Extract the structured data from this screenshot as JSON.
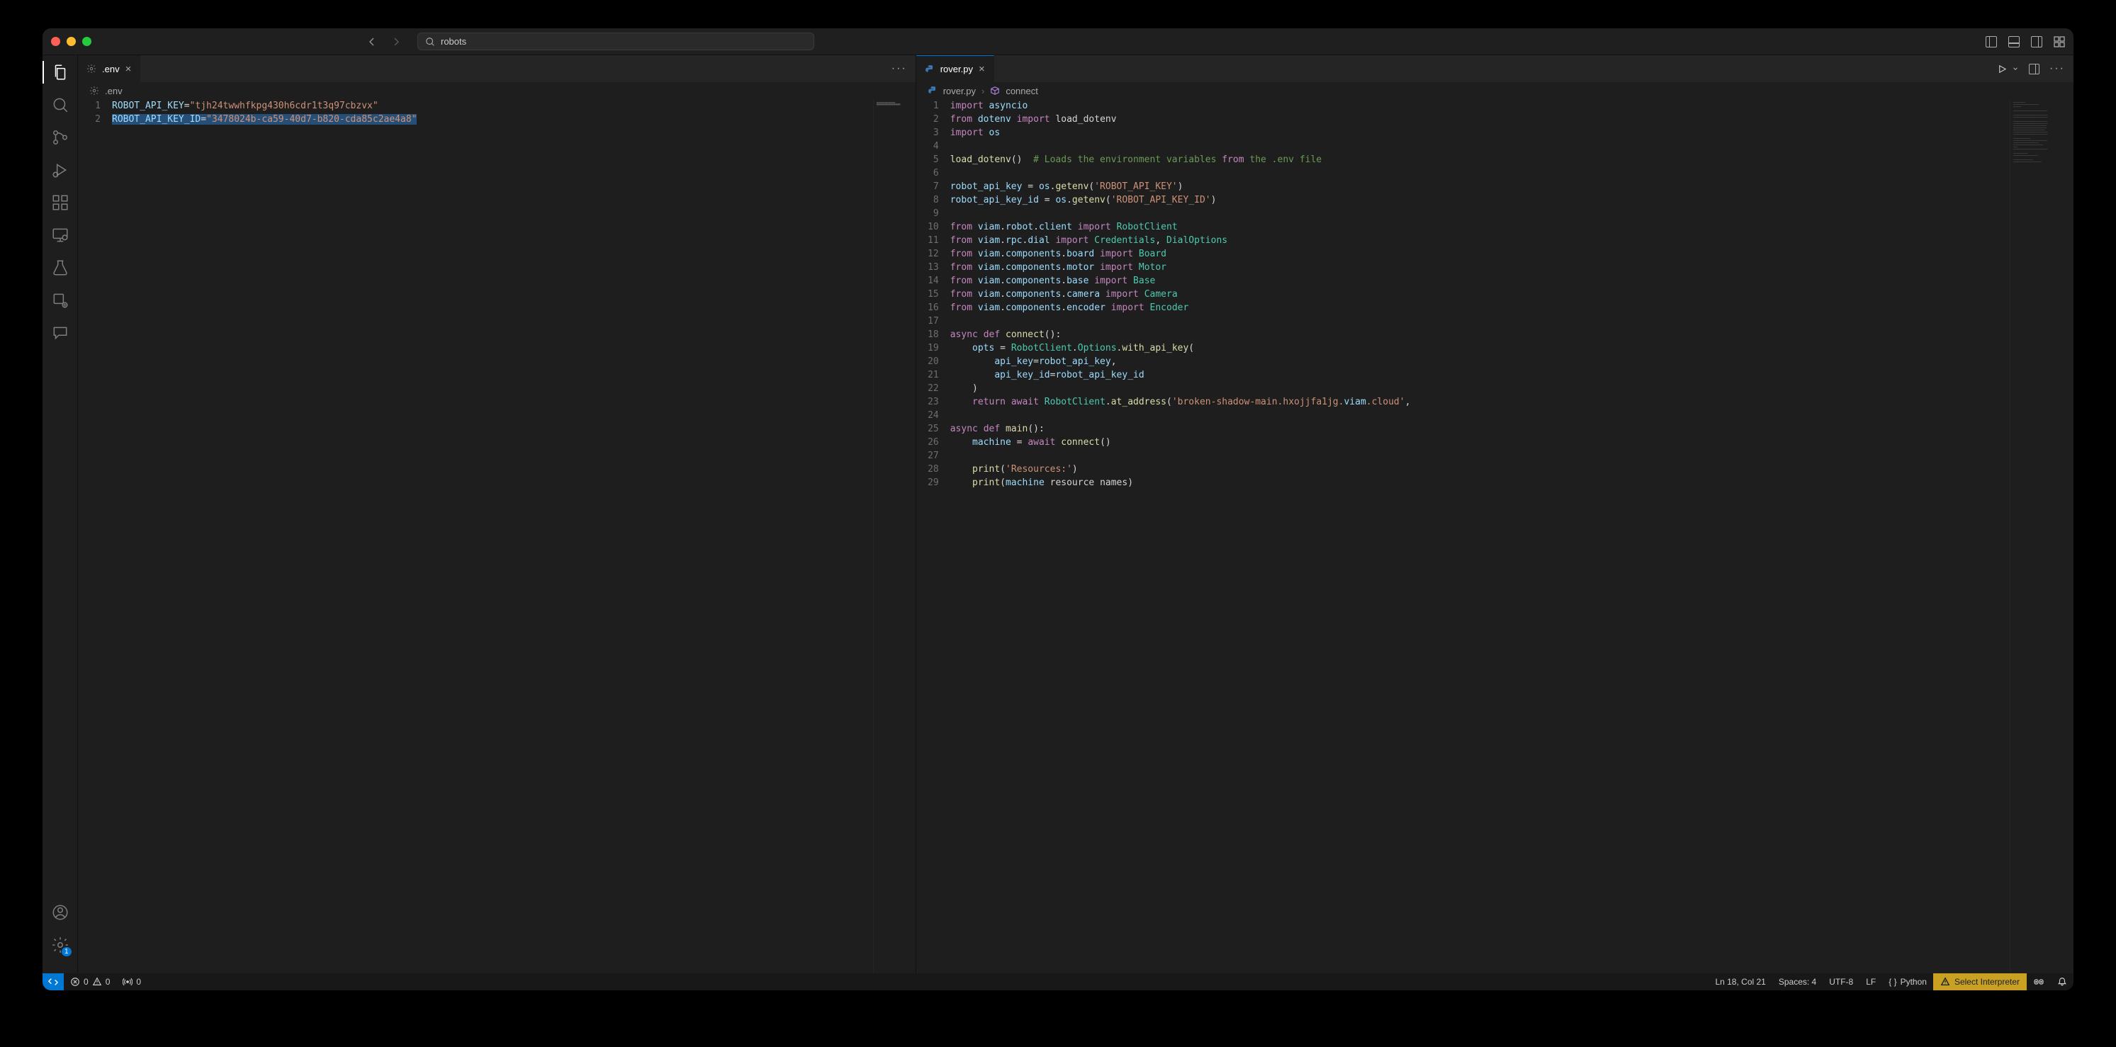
{
  "titlebar": {
    "search_text": "robots"
  },
  "left_editor": {
    "tab_label": ".env",
    "breadcrumb": ".env",
    "lines": [
      {
        "n": "1",
        "key": "ROBOT_API_KEY",
        "val": "\"tjh24twwhfkpg430h6cdr1t3q97cbzvx\""
      },
      {
        "n": "2",
        "key": "ROBOT_API_KEY_ID",
        "val": "\"3478024b-ca59-40d7-b820-cda85c2ae4a8\""
      }
    ]
  },
  "right_editor": {
    "tab_label": "rover.py",
    "breadcrumb_file": "rover.py",
    "breadcrumb_symbol": "connect",
    "code_raw": [
      "import asyncio",
      "from dotenv import load_dotenv",
      "import os",
      "",
      "load_dotenv()  # Loads the environment variables from the .env file",
      "",
      "robot_api_key = os.getenv('ROBOT_API_KEY')",
      "robot_api_key_id = os.getenv('ROBOT_API_KEY_ID')",
      "",
      "from viam.robot.client import RobotClient",
      "from viam.rpc.dial import Credentials, DialOptions",
      "from viam.components.board import Board",
      "from viam.components.motor import Motor",
      "from viam.components.base import Base",
      "from viam.components.camera import Camera",
      "from viam.components.encoder import Encoder",
      "",
      "async def connect():",
      "    opts = RobotClient.Options.with_api_key(",
      "        api_key=robot_api_key,",
      "        api_key_id=robot_api_key_id",
      "    )",
      "    return await RobotClient.at_address('broken-shadow-main.hxojjfa1jg.viam.cloud',",
      "",
      "async def main():",
      "    machine = await connect()",
      "",
      "    print('Resources:')",
      "    print(machine resource names)"
    ],
    "line_numbers": [
      "1",
      "2",
      "3",
      "4",
      "5",
      "6",
      "7",
      "8",
      "9",
      "10",
      "11",
      "12",
      "13",
      "14",
      "15",
      "16",
      "17",
      "18",
      "19",
      "20",
      "21",
      "22",
      "23",
      "24",
      "25",
      "26",
      "27",
      "28",
      "29"
    ]
  },
  "statusbar": {
    "errors": "0",
    "warnings": "0",
    "ports": "0",
    "position": "Ln 18, Col 21",
    "spaces": "Spaces: 4",
    "encoding": "UTF-8",
    "eol": "LF",
    "lang": "Python",
    "interpreter": "Select Interpreter"
  },
  "activitybar": {
    "settings_badge": "1"
  }
}
